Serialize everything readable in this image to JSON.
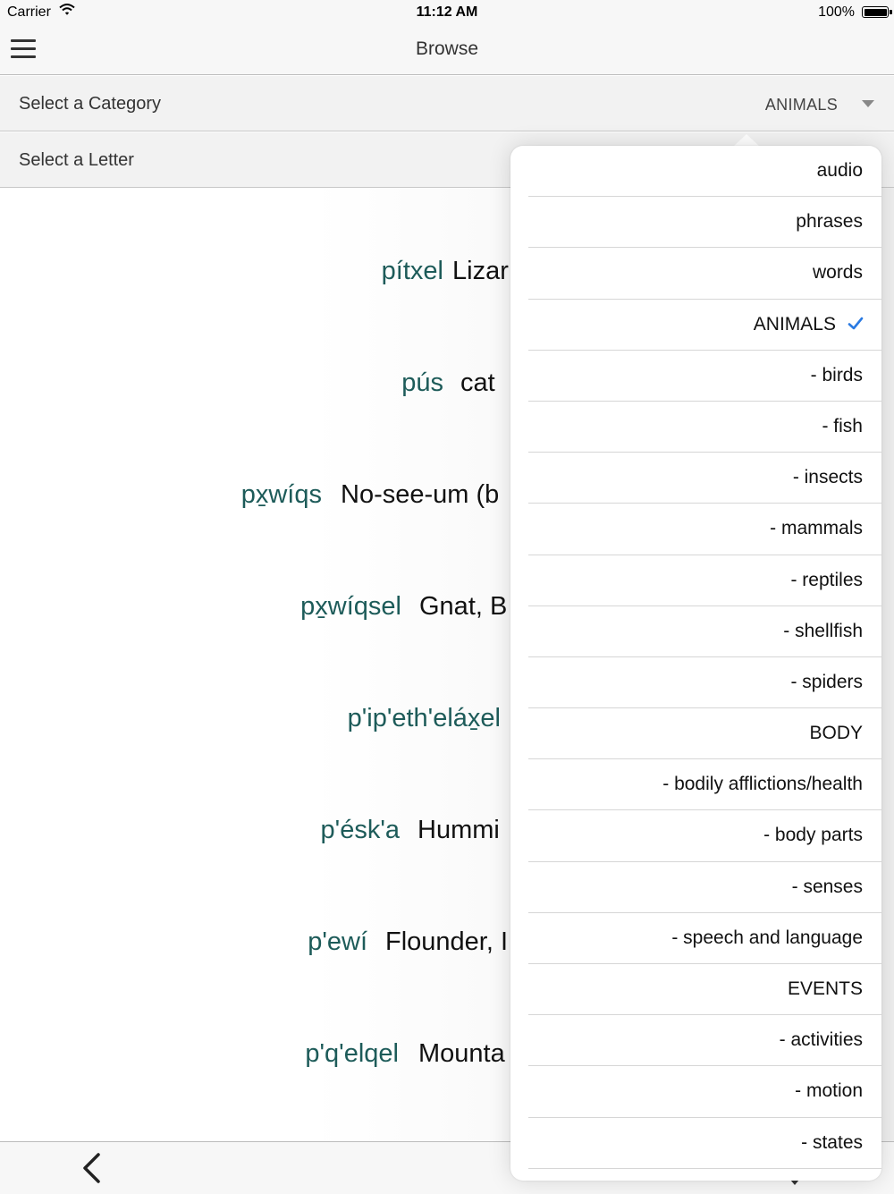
{
  "status_bar": {
    "carrier": "Carrier",
    "time": "11:12 AM",
    "battery": "100%"
  },
  "nav": {
    "title": "Browse",
    "menu_icon": "hamburger-icon"
  },
  "filters": {
    "category_label": "Select a Category",
    "category_value": "ANIMALS",
    "letter_label": "Select a Letter"
  },
  "entries": [
    {
      "native": "pítxel",
      "english": "Lizar"
    },
    {
      "native": "pús",
      "english": "cat"
    },
    {
      "native": "px̱wíqs",
      "english": "No-see-um (b"
    },
    {
      "native": "px̱wíqsel",
      "english": "Gnat, B"
    },
    {
      "native": "p'ip'eth'eláx̱el",
      "english": ""
    },
    {
      "native": "p'ésk'a",
      "english": "Hummi"
    },
    {
      "native": "p'ewí",
      "english": "Flounder, I"
    },
    {
      "native": "p'q'elqel",
      "english": "Mounta"
    }
  ],
  "category_menu": {
    "selected": "ANIMALS",
    "selected_icon": "checkmark-icon",
    "items": [
      "audio",
      "phrases",
      "words",
      "ANIMALS",
      "- birds",
      "- fish",
      "- insects",
      "- mammals",
      "- reptiles",
      "- shellfish",
      "- spiders",
      "BODY",
      "- bodily afflictions/health",
      "- body parts",
      "- senses",
      "- speech and language",
      "EVENTS",
      "- activities",
      "- motion",
      "- states"
    ]
  },
  "colors": {
    "native_text": "#1d5b59",
    "check": "#2a7ae2"
  },
  "bottom_bar": {
    "back_icon": "chevron-left-icon"
  }
}
